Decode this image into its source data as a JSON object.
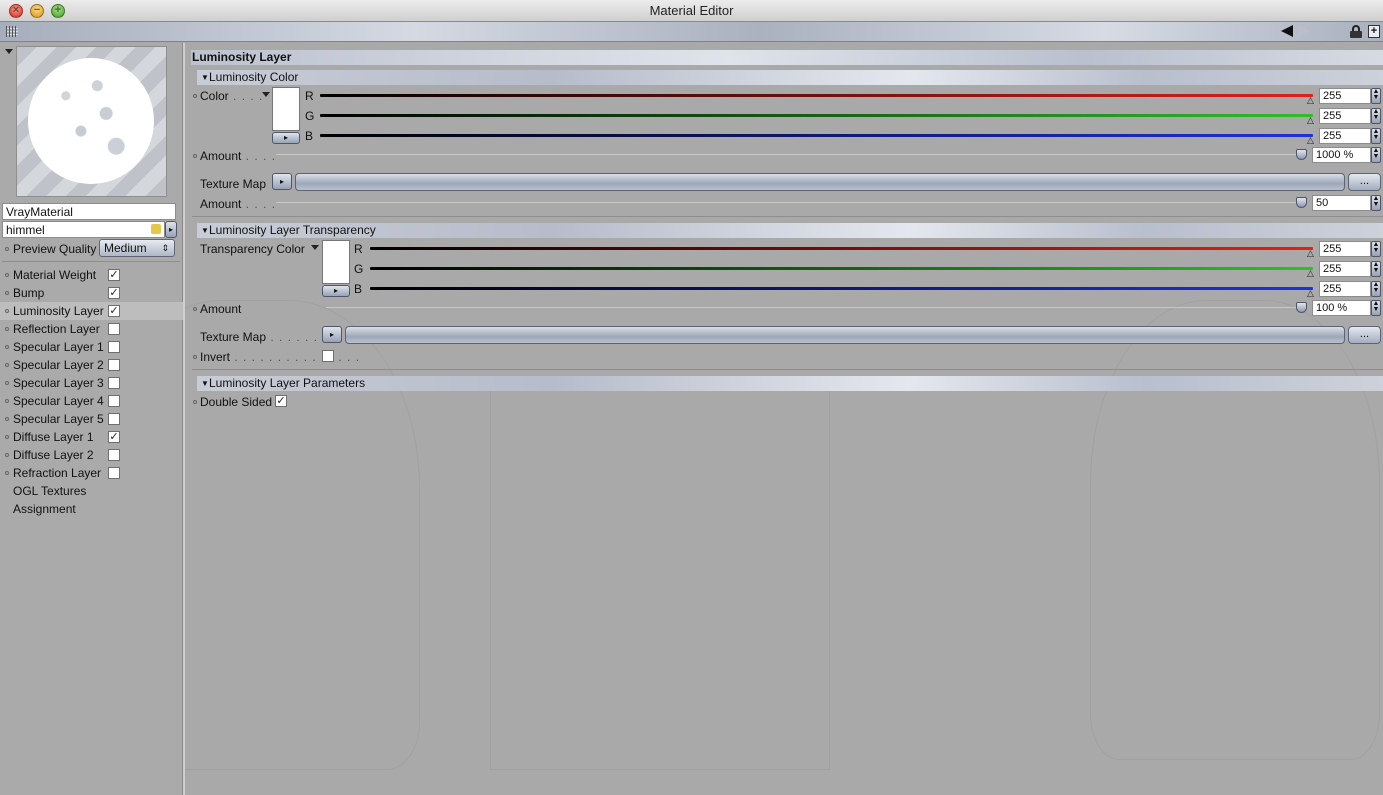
{
  "window": {
    "title": "Material Editor"
  },
  "sidebar": {
    "material_name": "VrayMaterial",
    "texture_name": "himmel",
    "preview_quality_label": "Preview Quality",
    "preview_quality_value": "Medium",
    "channels": [
      {
        "label": "Material Weight",
        "checked": true,
        "has_checkbox": true
      },
      {
        "label": "Bump",
        "checked": true,
        "has_checkbox": true
      },
      {
        "label": "Luminosity Layer",
        "checked": true,
        "has_checkbox": true,
        "active": true
      },
      {
        "label": "Reflection Layer",
        "checked": false,
        "has_checkbox": true
      },
      {
        "label": "Specular Layer 1",
        "checked": false,
        "has_checkbox": true
      },
      {
        "label": "Specular Layer 2",
        "checked": false,
        "has_checkbox": true
      },
      {
        "label": "Specular Layer 3",
        "checked": false,
        "has_checkbox": true
      },
      {
        "label": "Specular Layer 4",
        "checked": false,
        "has_checkbox": true
      },
      {
        "label": "Specular Layer 5",
        "checked": false,
        "has_checkbox": true
      },
      {
        "label": "Diffuse Layer 1",
        "checked": true,
        "has_checkbox": true
      },
      {
        "label": "Diffuse Layer 2",
        "checked": false,
        "has_checkbox": true
      },
      {
        "label": "Refraction Layer",
        "checked": false,
        "has_checkbox": true
      },
      {
        "label": "OGL Textures",
        "has_checkbox": false
      },
      {
        "label": "Assignment",
        "has_checkbox": false
      }
    ]
  },
  "main": {
    "title": "Luminosity Layer",
    "luminosity_color": {
      "header": "Luminosity Color",
      "color_label": "Color",
      "r_label": "R",
      "g_label": "G",
      "b_label": "B",
      "r": "255",
      "g": "255",
      "b": "255",
      "amount_label": "Amount",
      "amount": "1000 %",
      "texture_map_label": "Texture Map",
      "texture_browse": "...",
      "tex_amount_label": "Amount",
      "tex_amount": "50"
    },
    "transparency": {
      "header": "Luminosity Layer Transparency",
      "color_label": "Transparency Color",
      "r_label": "R",
      "g_label": "G",
      "b_label": "B",
      "r": "255",
      "g": "255",
      "b": "255",
      "amount_label": "Amount",
      "amount": "100 %",
      "texture_map_label": "Texture Map",
      "texture_browse": "...",
      "invert_label": "Invert",
      "invert_checked": false
    },
    "parameters": {
      "header": "Luminosity Layer Parameters",
      "double_sided_label": "Double Sided",
      "double_sided_checked": true
    }
  },
  "colors": {
    "red_channel": "#e0201c",
    "green_channel": "#2fbf2a",
    "blue_channel": "#2030e0"
  }
}
